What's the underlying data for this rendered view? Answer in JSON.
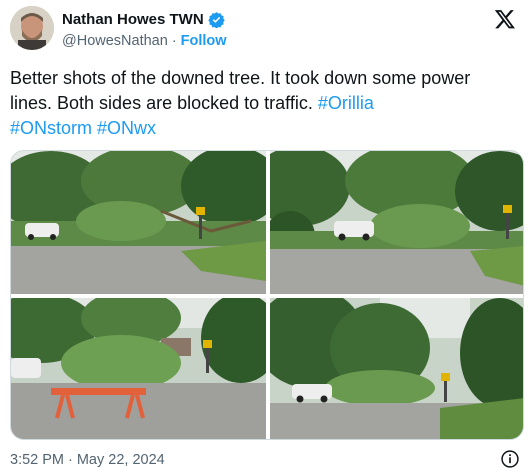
{
  "author": {
    "name": "Nathan Howes TWN",
    "handle": "@HowesNathan",
    "separator": "·",
    "follow_label": "Follow"
  },
  "tweet": {
    "text_before": "Better shots of the downed tree. It took down some power lines. Both sides are blocked to traffic. ",
    "hashtags": [
      "#Orillia",
      "#ONstorm",
      "#ONwx"
    ]
  },
  "footer": {
    "time": "3:52 PM",
    "separator": "·",
    "date": "May 22, 2024"
  },
  "icons": {
    "verified": "verified-badge-icon",
    "logo": "x-logo-icon",
    "info": "info-icon"
  },
  "colors": {
    "accent": "#1d9bf0",
    "text": "#0f1419",
    "secondary": "#536471"
  }
}
